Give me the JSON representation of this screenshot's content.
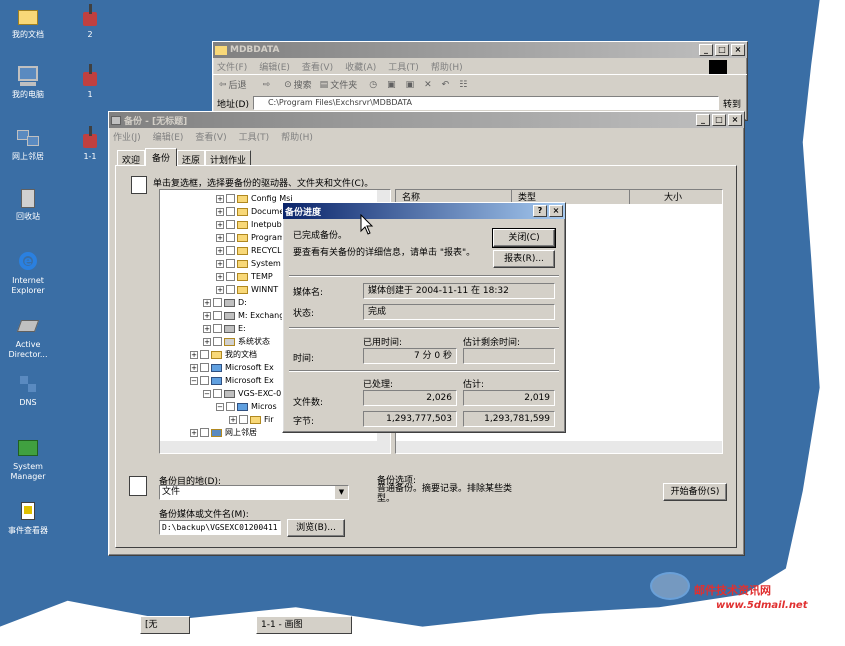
{
  "desktop": {
    "icons": [
      {
        "label": "我的文档",
        "icon": "folder-icon"
      },
      {
        "label": "2",
        "icon": "paint-icon"
      },
      {
        "label": "我的电脑",
        "icon": "computer-icon"
      },
      {
        "label": "1",
        "icon": "paint-icon"
      },
      {
        "label": "网上邻居",
        "icon": "network-icon"
      },
      {
        "label": "1-1",
        "icon": "paint-icon"
      },
      {
        "label": "回收站",
        "icon": "recycle-icon"
      },
      {
        "label": "Internet Explorer",
        "icon": "ie-icon"
      },
      {
        "label": "Active Director...",
        "icon": "ad-icon"
      },
      {
        "label": "DNS",
        "icon": "dns-icon"
      },
      {
        "label": "System Manager",
        "icon": "sysman-icon"
      },
      {
        "label": "事件查看器",
        "icon": "event-icon"
      }
    ]
  },
  "explorer": {
    "title": "MDBDATA",
    "menu": [
      "文件(F)",
      "编辑(E)",
      "查看(V)",
      "收藏(A)",
      "工具(T)",
      "帮助(H)"
    ],
    "toolbar": {
      "back": "后退",
      "search": "搜索",
      "folders": "文件夹"
    },
    "address_label": "地址(D)",
    "address": "C:\\Program Files\\Exchsrvr\\MDBDATA",
    "go": "转到"
  },
  "backup": {
    "title": "备份 - [无标题]",
    "menu": [
      "作业(J)",
      "编辑(E)",
      "查看(V)",
      "工具(T)",
      "帮助(H)"
    ],
    "tabs": [
      "欢迎",
      "备份",
      "还原",
      "计划作业"
    ],
    "instruction": "单击复选框，选择要备份的驱动器、文件夹和文件(C)。",
    "columns": [
      "名称",
      "类型",
      "大小"
    ],
    "tree": [
      "Config Msi",
      "Documents",
      "Inetpub",
      "Program",
      "RECYCLER",
      "System",
      "TEMP",
      "WINNT",
      "D:",
      "M: Exchange",
      "E:",
      "系统状态",
      "我的文档",
      "Microsoft Ex",
      "Microsoft Ex",
      "VGS-EXC-0",
      "Micros",
      "Fir",
      "网上邻居"
    ],
    "dest_label": "备份目的地(D):",
    "dest_value": "文件",
    "options_label": "备份选项:",
    "options_text": "普通备份。摘要记录。排除某些类型。",
    "media_label": "备份媒体或文件名(M):",
    "media_value": "D:\\backup\\VGSEXC01200411",
    "browse": "浏览(B)...",
    "start": "开始备份(S)"
  },
  "dialog": {
    "title": "备份进度",
    "help": "?",
    "done": "已完成备份。",
    "hint": "要查看有关备份的详细信息，请单击 \"报表\"。",
    "close": "关闭(C)",
    "report": "报表(R)...",
    "media_label": "媒体名:",
    "media_value": "媒体创建于 2004-11-11 在 18:32",
    "status_label": "状态:",
    "status_value": "完成",
    "elapsed_label": "已用时间:",
    "remaining_label": "估计剩余时间:",
    "time_label": "时间:",
    "time_value": "7 分 0 秒",
    "time_remaining": "",
    "processed_label": "已处理:",
    "estimated_label": "估计:",
    "files_label": "文件数:",
    "files_processed": "2,026",
    "files_estimated": "2,019",
    "bytes_label": "字节:",
    "bytes_processed": "1,293,777,503",
    "bytes_estimated": "1,293,781,599"
  },
  "taskbar": {
    "items": [
      "[无",
      "1-1 - 画图"
    ]
  },
  "watermark": {
    "name": "邮件技术资讯网",
    "url": "www.5dmail.net"
  }
}
